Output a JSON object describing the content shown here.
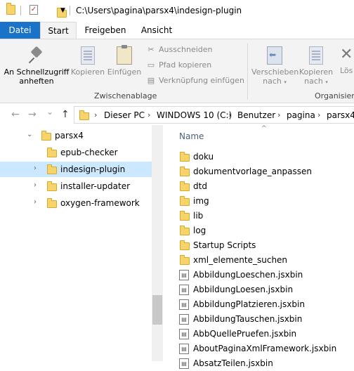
{
  "titlebar": {
    "path": "C:\\Users\\pagina\\parsx4\\indesign-plugin",
    "check_glyph": "✓",
    "dropdown_glyph": "▼"
  },
  "ribbon_tabs": [
    {
      "label": "Datei"
    },
    {
      "label": "Start"
    },
    {
      "label": "Freigeben"
    },
    {
      "label": "Ansicht"
    }
  ],
  "ribbon": {
    "pin_label_1": "An Schnellzugriff",
    "pin_label_2": "anheften",
    "copy_label": "Kopieren",
    "paste_label": "Einfügen",
    "cut_label": "Ausschneiden",
    "copy_path_label": "Pfad kopieren",
    "paste_link_label": "Verknüpfung einfügen",
    "clipboard_group": "Zwischenablage",
    "move_label_1": "Verschieben",
    "move_label_2": "nach",
    "copyto_label_1": "Kopieren",
    "copyto_label_2": "nach",
    "delete_label": "Lös",
    "organize_group": "Organisier",
    "cut_icon": "scissors-icon",
    "copy_path_icon": "copy-path-icon",
    "paste_link_icon": "paste-shortcut-icon"
  },
  "nav": {
    "back": "←",
    "forward": "→",
    "recent": "⌄",
    "up": "↑",
    "crumbs": [
      "Dieser PC",
      "WINDOWS 10 (C:)",
      "Benutzer",
      "pagina",
      "parsx4"
    ],
    "crumb_sep": "›"
  },
  "tree": {
    "items": [
      {
        "label": "parsx4",
        "chevron": "⌄"
      },
      {
        "label": "epub-checker",
        "chevron": ""
      },
      {
        "label": "indesign-plugin",
        "chevron": "›"
      },
      {
        "label": "installer-updater",
        "chevron": "›"
      },
      {
        "label": "oxygen-framework",
        "chevron": "›"
      }
    ]
  },
  "content": {
    "column_name": "Name",
    "sort_glyph": "^",
    "items": [
      {
        "name": "doku",
        "type": "folder"
      },
      {
        "name": "dokumentvorlage_anpassen",
        "type": "folder"
      },
      {
        "name": "dtd",
        "type": "folder"
      },
      {
        "name": "img",
        "type": "folder"
      },
      {
        "name": "lib",
        "type": "folder"
      },
      {
        "name": "log",
        "type": "folder"
      },
      {
        "name": "Startup Scripts",
        "type": "folder"
      },
      {
        "name": "xml_elemente_suchen",
        "type": "folder"
      },
      {
        "name": "AbbildungLoeschen.jsxbin",
        "type": "file"
      },
      {
        "name": "AbbildungLoesen.jsxbin",
        "type": "file"
      },
      {
        "name": "AbbildungPlatzieren.jsxbin",
        "type": "file"
      },
      {
        "name": "AbbildungTauschen.jsxbin",
        "type": "file"
      },
      {
        "name": "AbbQuellePruefen.jsxbin",
        "type": "file"
      },
      {
        "name": "AboutPaginaXmlFramework.jsxbin",
        "type": "file"
      },
      {
        "name": "AbsatzTeilen.jsxbin",
        "type": "file"
      }
    ]
  },
  "colors": {
    "accent": "#1a73c8",
    "selection": "#cce8ff",
    "folder": "#f7d469"
  }
}
